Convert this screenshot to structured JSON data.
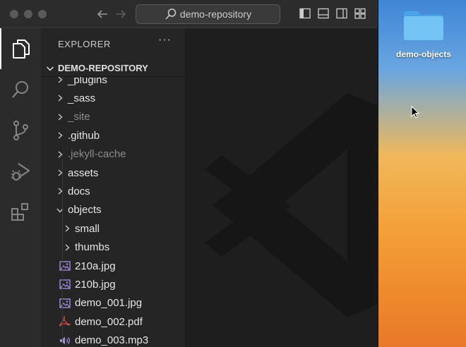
{
  "titlebar": {
    "search_text": "demo-repository"
  },
  "explorer": {
    "header": "EXPLORER",
    "more": "···",
    "repo_name": "DEMO-REPOSITORY"
  },
  "tree": {
    "items": [
      {
        "label": "_plugins",
        "type": "folder",
        "expanded": false,
        "dim": false
      },
      {
        "label": "_sass",
        "type": "folder",
        "expanded": false,
        "dim": false
      },
      {
        "label": "_site",
        "type": "folder",
        "expanded": false,
        "dim": true
      },
      {
        "label": ".github",
        "type": "folder",
        "expanded": false,
        "dim": false
      },
      {
        "label": ".jekyll-cache",
        "type": "folder",
        "expanded": false,
        "dim": true
      },
      {
        "label": "assets",
        "type": "folder",
        "expanded": false,
        "dim": false
      },
      {
        "label": "docs",
        "type": "folder",
        "expanded": false,
        "dim": false
      },
      {
        "label": "objects",
        "type": "folder",
        "expanded": true,
        "dim": false
      },
      {
        "label": "small",
        "type": "folder",
        "expanded": false,
        "dim": false
      },
      {
        "label": "thumbs",
        "type": "folder",
        "expanded": false,
        "dim": false
      },
      {
        "label": "210a.jpg",
        "type": "image",
        "dim": false
      },
      {
        "label": "210b.jpg",
        "type": "image",
        "dim": false
      },
      {
        "label": "demo_001.jpg",
        "type": "image",
        "dim": false
      },
      {
        "label": "demo_002.pdf",
        "type": "pdf",
        "dim": false
      },
      {
        "label": "demo_003.mp3",
        "type": "audio",
        "dim": false
      }
    ]
  },
  "desktop": {
    "folder_label": "demo-objects"
  },
  "colors": {
    "accent_folder": "#5eb4ee",
    "pdf_icon": "#e04545",
    "image_icon": "#a28be0",
    "audio_icon": "#a28be0"
  }
}
